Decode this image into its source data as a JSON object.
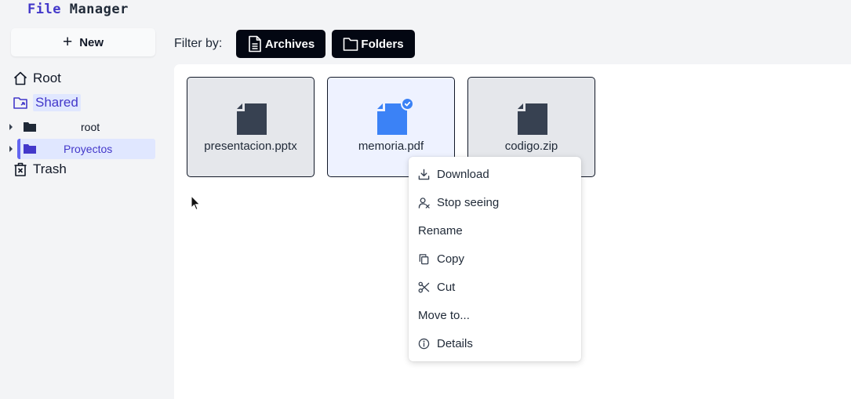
{
  "app": {
    "title_part1": "File",
    "title_part2": "Manager"
  },
  "sidebar": {
    "new_button": {
      "icon": "plus-icon",
      "label": "New"
    },
    "nav": [
      {
        "label": "Root",
        "icon": "home-icon"
      },
      {
        "label": "Shared",
        "icon": "shared-folder-icon"
      },
      {
        "label": "Trash",
        "icon": "trash-icon"
      }
    ],
    "tree": [
      {
        "label": "root",
        "icon": "folder-icon"
      },
      {
        "label": "Proyectos",
        "icon": "folder-icon",
        "selected": true
      }
    ]
  },
  "filter": {
    "label": "Filter by:",
    "buttons": [
      {
        "label": "Archives",
        "icon": "document-icon"
      },
      {
        "label": "Folders",
        "icon": "folder-icon"
      }
    ]
  },
  "files": [
    {
      "name": "presentacion.pptx",
      "icon": "file-icon",
      "color": "#374151"
    },
    {
      "name": "memoria.pdf",
      "icon": "file-icon",
      "color": "#3b82f6",
      "selected": true
    },
    {
      "name": "codigo.zip",
      "icon": "file-icon",
      "color": "#374151"
    }
  ],
  "context_menu": {
    "items": [
      {
        "label": "Download",
        "icon": "download-icon"
      },
      {
        "label": "Stop seeing",
        "icon": "user-remove-icon"
      },
      {
        "label": "Rename",
        "icon": ""
      },
      {
        "label": "Copy",
        "icon": "copy-icon"
      },
      {
        "label": "Cut",
        "icon": "scissors-icon"
      },
      {
        "label": "Move to...",
        "icon": ""
      },
      {
        "label": "Details",
        "icon": "info-icon"
      }
    ]
  },
  "colors": {
    "accent": "#4338ca",
    "selection_bg": "#e0e7ff",
    "selected_file": "#3b82f6",
    "file_icon": "#374151",
    "dark_button": "#030712"
  }
}
